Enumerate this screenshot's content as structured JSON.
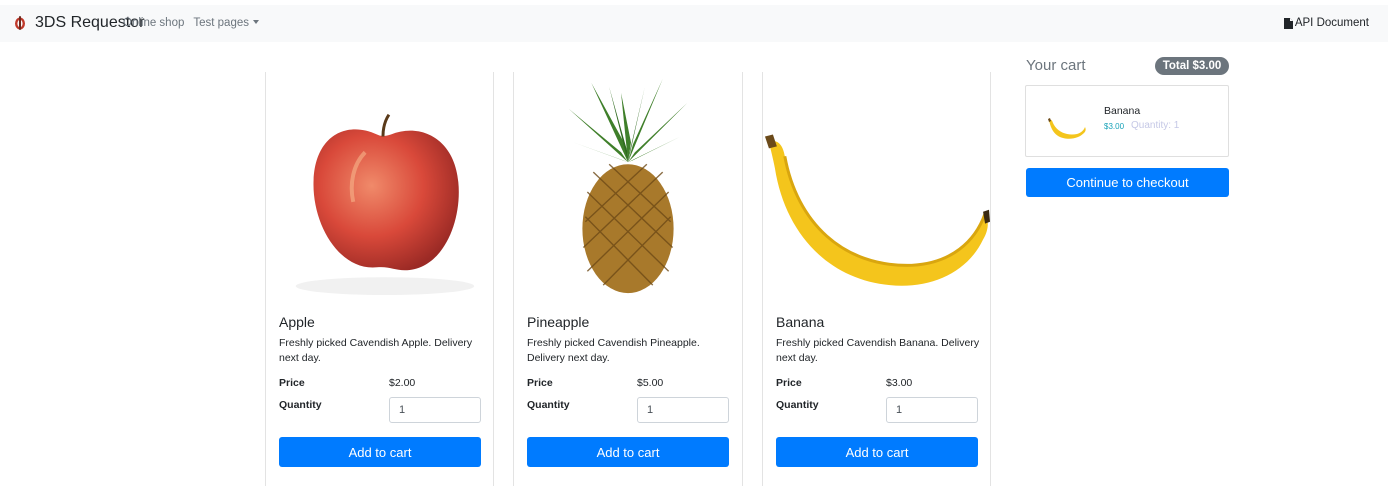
{
  "navbar": {
    "brand_name": "3DS Requestor",
    "links": [
      {
        "label": "Online shop"
      },
      {
        "label": "Test pages"
      }
    ],
    "api_document": "API Document"
  },
  "products": [
    {
      "name": "Apple",
      "description": "Freshly picked Cavendish Apple. Delivery next day.",
      "price_label": "Price",
      "price": "$2.00",
      "quantity_label": "Quantity",
      "quantity": "1",
      "button": "Add to cart"
    },
    {
      "name": "Pineapple",
      "description": "Freshly picked Cavendish Pineapple. Delivery next day.",
      "price_label": "Price",
      "price": "$5.00",
      "quantity_label": "Quantity",
      "quantity": "1",
      "button": "Add to cart"
    },
    {
      "name": "Banana",
      "description": "Freshly picked Cavendish Banana. Delivery next day.",
      "price_label": "Price",
      "price": "$3.00",
      "quantity_label": "Quantity",
      "quantity": "1",
      "button": "Add to cart"
    }
  ],
  "cart": {
    "title": "Your cart",
    "total": "Total $3.00",
    "items": [
      {
        "name": "Banana",
        "price": "$3.00",
        "quantity": "Quantity: 1"
      }
    ],
    "checkout": "Continue to checkout"
  },
  "colors": {
    "primary": "#007bff",
    "navbar_bg": "#f8f9fa",
    "badge": "#6c757d",
    "price_accent": "#17a2b8"
  }
}
